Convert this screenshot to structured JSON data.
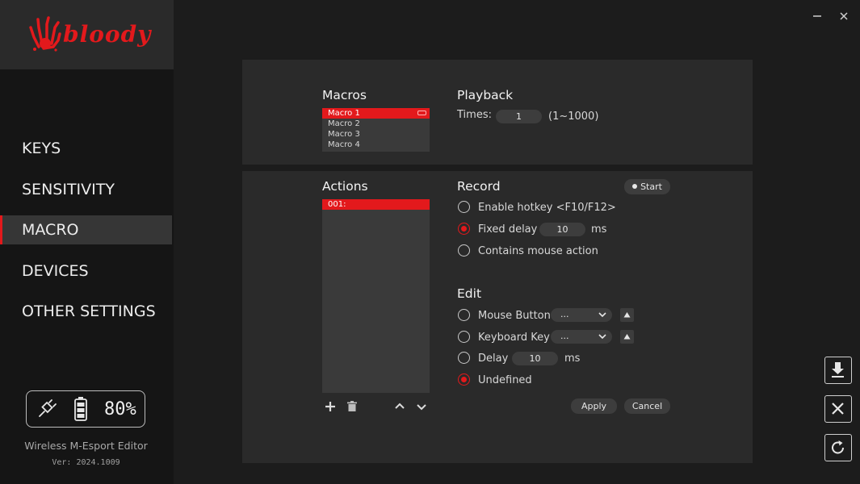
{
  "brand": {
    "logo_text": "bloody",
    "accent": "#e3191c"
  },
  "window": {
    "minimize_icon": "minimize-icon",
    "close_icon": "close-icon"
  },
  "sidebar": {
    "items": [
      {
        "label": "KEYS",
        "active": false
      },
      {
        "label": "SENSITIVITY",
        "active": false
      },
      {
        "label": "MACRO",
        "active": true
      },
      {
        "label": "DEVICES",
        "active": false
      },
      {
        "label": "OTHER SETTINGS",
        "active": false
      }
    ],
    "battery": {
      "percent_label": "80%",
      "level": 0.8
    },
    "app_name": "Wireless M-Esport Editor",
    "version": "Ver: 2024.1009"
  },
  "macros": {
    "title": "Macros",
    "items": [
      "Macro 1",
      "Macro 2",
      "Macro 3",
      "Macro 4"
    ],
    "selected_index": 0
  },
  "playback": {
    "title": "Playback",
    "times_label": "Times:",
    "times_value": "1",
    "times_range": "(1~1000)"
  },
  "actions": {
    "title": "Actions",
    "items": [
      "001:"
    ],
    "selected_index": 0
  },
  "record": {
    "title": "Record",
    "start_label": "Start",
    "options": {
      "hotkey": {
        "label": "Enable hotkey <F10/F12>",
        "checked": false
      },
      "fixed_delay": {
        "label": "Fixed delay",
        "checked": true,
        "value": "10",
        "unit": "ms"
      },
      "mouse_action": {
        "label": "Contains mouse action",
        "checked": false
      }
    }
  },
  "edit": {
    "title": "Edit",
    "mouse_button": {
      "label": "Mouse Button",
      "value": "...",
      "checked": false
    },
    "keyboard_key": {
      "label": "Keyboard Key",
      "value": "...",
      "checked": false
    },
    "delay": {
      "label": "Delay",
      "value": "10",
      "unit": "ms",
      "checked": false
    },
    "undefined": {
      "label": "Undefined",
      "checked": true
    },
    "apply_label": "Apply",
    "cancel_label": "Cancel"
  }
}
